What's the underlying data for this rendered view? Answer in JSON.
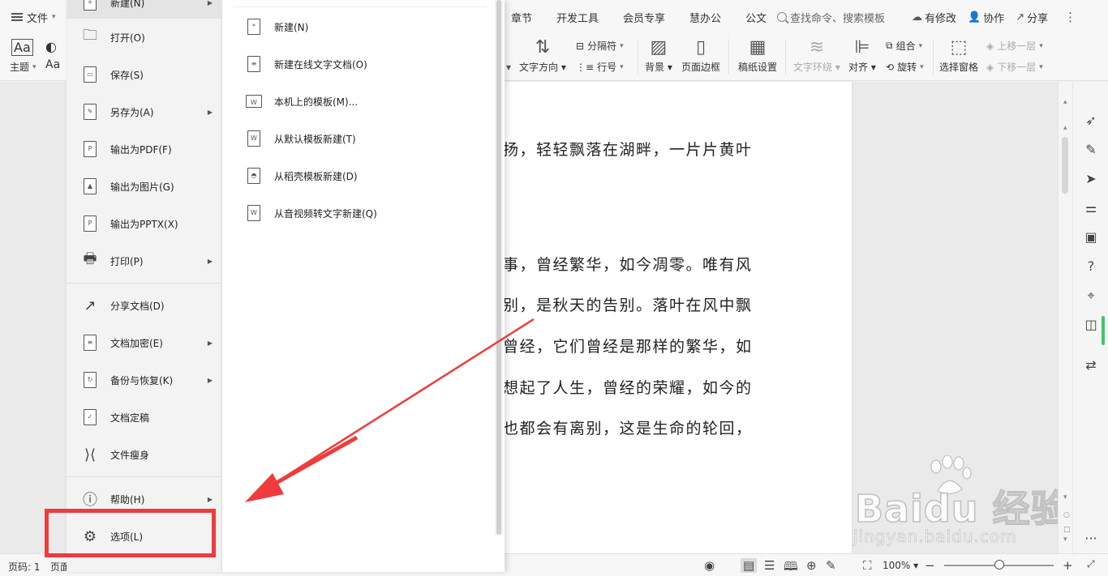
{
  "file_tab": {
    "label": "文件"
  },
  "tabs": [
    "章节",
    "开发工具",
    "会员专享",
    "慧办公",
    "公文"
  ],
  "search": {
    "placeholder": "查找命令、搜索模板"
  },
  "topright": {
    "revise": "有修改",
    "collab": "协作",
    "share": "分享"
  },
  "ribbon": {
    "theme": "主题",
    "font_aa": "Aa",
    "separator": "分隔符",
    "text_direction": "文字方向",
    "line_number": "行号",
    "background": "背景",
    "page_border": "页面边框",
    "manuscript": "稿纸设置",
    "text_wrap": "文字环绕",
    "align": "对齐",
    "group": "组合",
    "rotate": "旋转",
    "selection_pane": "选择窗格",
    "bring_forward": "上移一层",
    "send_backward": "下移一层"
  },
  "file_menu": {
    "items": [
      {
        "label": "新建(N)",
        "arrow": true
      },
      {
        "label": "打开(O)",
        "arrow": false
      },
      {
        "label": "保存(S)",
        "arrow": false
      },
      {
        "label": "另存为(A)",
        "arrow": true
      },
      {
        "label": "输出为PDF(F)",
        "arrow": false
      },
      {
        "label": "输出为图片(G)",
        "arrow": false
      },
      {
        "label": "输出为PPTX(X)",
        "arrow": false
      },
      {
        "label": "打印(P)",
        "arrow": true
      },
      {
        "label": "分享文档(D)",
        "arrow": false
      },
      {
        "label": "文档加密(E)",
        "arrow": true
      },
      {
        "label": "备份与恢复(K)",
        "arrow": true
      },
      {
        "label": "文档定稿",
        "arrow": false
      },
      {
        "label": "文件瘦身",
        "arrow": false
      },
      {
        "label": "帮助(H)",
        "arrow": true
      },
      {
        "label": "选项(L)",
        "arrow": false
      }
    ]
  },
  "new_submenu": {
    "items": [
      {
        "label": "新建(N)"
      },
      {
        "label": "新建在线文字文档(O)"
      },
      {
        "label": "本机上的模板(M)..."
      },
      {
        "label": "从默认模板新建(T)"
      },
      {
        "label": "从稻壳模板新建(D)"
      },
      {
        "label": "从音视频转文字新建(Q)"
      }
    ]
  },
  "document": {
    "lines": [
      "扬，轻轻飘落在湖畔，一片片黄叶",
      "事，曾经繁华，如今凋零。唯有风",
      "别，是秋天的告别。落叶在风中飘",
      "曾经，它们曾经是那样的繁华，如",
      "想起了人生，曾经的荣耀，如今的",
      "也都会有离别，这是生命的轮回，"
    ]
  },
  "statusbar": {
    "page": "页码: 1",
    "page2": "页面",
    "zoom": "100%"
  },
  "watermark": {
    "brand": "Bai",
    "brand2": "du",
    "cn": "经验",
    "url": "jingyan.baidu.com"
  },
  "colors": {
    "annotation_red": "#ef3b3b",
    "accent_green": "#3cc86a"
  }
}
